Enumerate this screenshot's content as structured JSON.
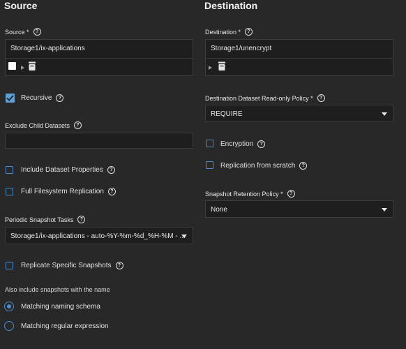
{
  "source": {
    "heading": "Source",
    "source_label": "Source *",
    "source_value": "Storage1/ix-applications",
    "recursive_label": "Recursive",
    "exclude_label": "Exclude Child Datasets",
    "exclude_value": "",
    "include_props_label": "Include Dataset Properties",
    "full_fs_label": "Full Filesystem Replication",
    "periodic_label": "Periodic Snapshot Tasks",
    "periodic_value": "Storage1/ix-applications - auto-%Y-%m-%d_%H-%M - ...",
    "replicate_specific_label": "Replicate Specific Snapshots",
    "also_include_label": "Also include snapshots with the name",
    "radio_naming_label": "Matching naming schema",
    "radio_regex_label": "Matching regular expression"
  },
  "destination": {
    "heading": "Destination",
    "destination_label": "Destination *",
    "destination_value": "Storage1/unencrypt",
    "readonly_label": "Destination Dataset Read-only Policy *",
    "readonly_value": "REQUIRE",
    "encryption_label": "Encryption",
    "from_scratch_label": "Replication from scratch",
    "retention_label": "Snapshot Retention Policy *",
    "retention_value": "None"
  },
  "help_glyph": "?",
  "icons": [
    "help-icon",
    "checkbox-icon",
    "expand-triangle-icon",
    "dataset-folder-icon",
    "dropdown-caret-icon",
    "radio-icon"
  ],
  "colors": {
    "background": "#282828",
    "field": "#1e1e1e",
    "accent": "#4a8ccc"
  }
}
